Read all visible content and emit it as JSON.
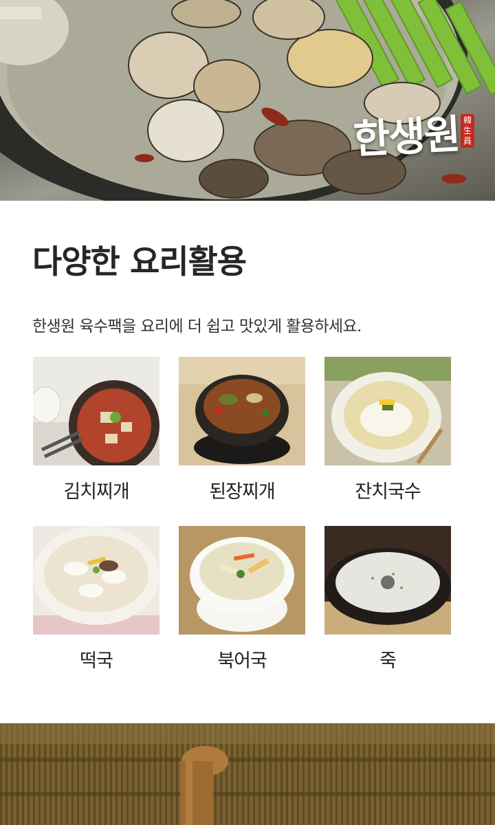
{
  "hero": {
    "brand_logo": "한생원",
    "brand_seal": [
      "韓",
      "生",
      "員"
    ]
  },
  "section": {
    "title": "다양한 요리활용",
    "description": "한생원 육수팩을 요리에 더 쉽고 맛있게 활용하세요."
  },
  "dishes": [
    {
      "label": "김치찌개",
      "icon": "kimchi-jjigae-photo"
    },
    {
      "label": "된장찌개",
      "icon": "doenjang-jjigae-photo"
    },
    {
      "label": "잔치국수",
      "icon": "janchi-guksu-photo"
    },
    {
      "label": "떡국",
      "icon": "tteokguk-photo"
    },
    {
      "label": "북어국",
      "icon": "bugeoguk-photo"
    },
    {
      "label": "죽",
      "icon": "juk-photo"
    }
  ],
  "colors": {
    "title": "#262626",
    "text": "#333333",
    "seal_red": "#c8281e"
  }
}
